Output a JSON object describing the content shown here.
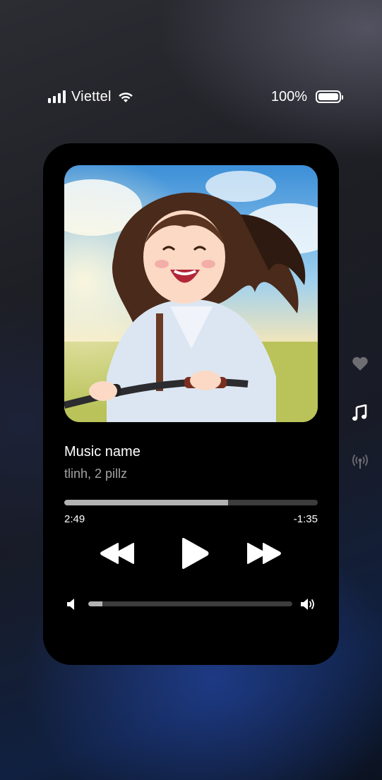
{
  "status_bar": {
    "carrier": "Viettel",
    "battery_percent": "100%",
    "signal_icon": "signal-bars-icon",
    "wifi_icon": "wifi-icon",
    "battery_icon": "battery-icon"
  },
  "player": {
    "song_title": "Music name",
    "artist": "tlinh, 2 pillz",
    "elapsed": "2:49",
    "remaining": "-1:35",
    "progress_fraction": 0.645,
    "volume_fraction": 0.07,
    "controls": {
      "rewind_icon": "rewind-icon",
      "play_icon": "play-icon",
      "fast_forward_icon": "fast-forward-icon",
      "volume_low_icon": "volume-low-icon",
      "volume_high_icon": "volume-high-icon"
    },
    "artwork_icon": "album-artwork"
  },
  "side_nav": {
    "items": [
      {
        "icon": "heart-icon",
        "active": false
      },
      {
        "icon": "music-note-icon",
        "active": true
      },
      {
        "icon": "broadcast-icon",
        "active": false
      }
    ]
  },
  "colors": {
    "card": "#000000",
    "progress_fill": "#b3b3b3",
    "progress_track": "#3c3c3c",
    "artist_text": "#a3a3a3",
    "inactive_icon": "#6e6e72"
  }
}
